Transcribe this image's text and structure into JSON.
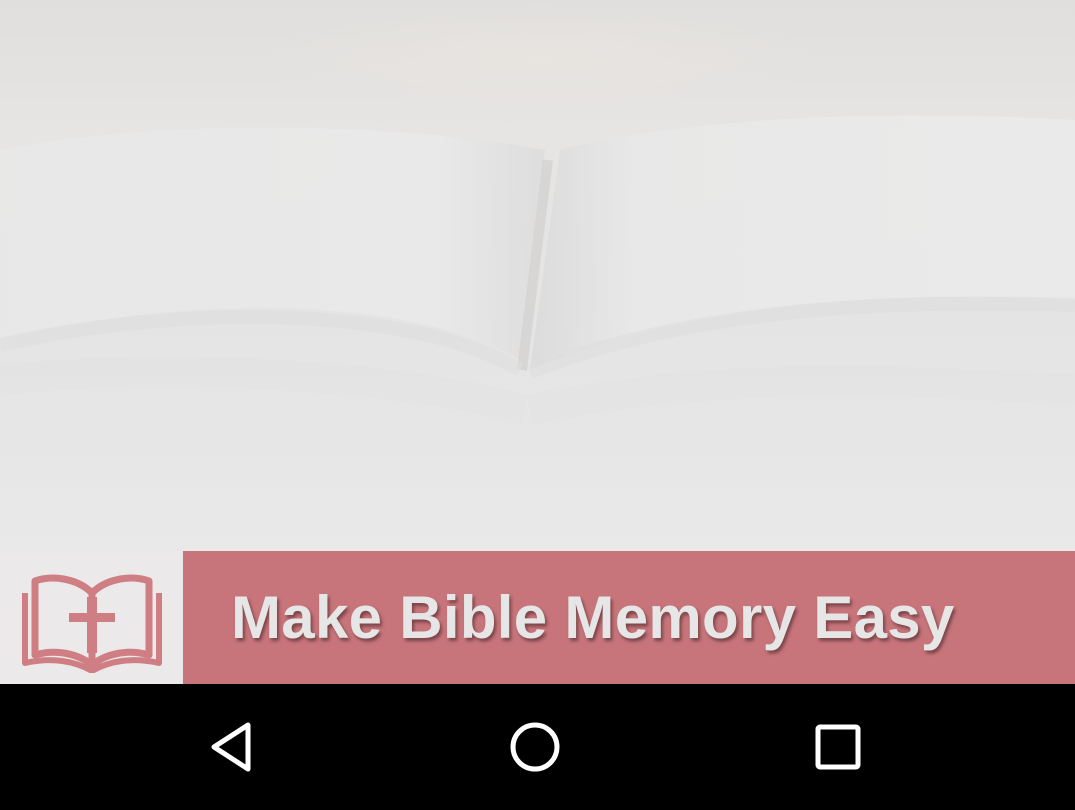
{
  "banner": {
    "tagline": "Make Bible Memory Easy"
  },
  "icons": {
    "logo": "bible-cross-icon",
    "back": "back-triangle-icon",
    "home": "home-circle-icon",
    "recents": "recents-square-icon"
  },
  "colors": {
    "banner_accent": "#c7757b",
    "logo_background": "#ebe9e9",
    "nav_background": "#000000",
    "nav_icon": "#ffffff"
  }
}
